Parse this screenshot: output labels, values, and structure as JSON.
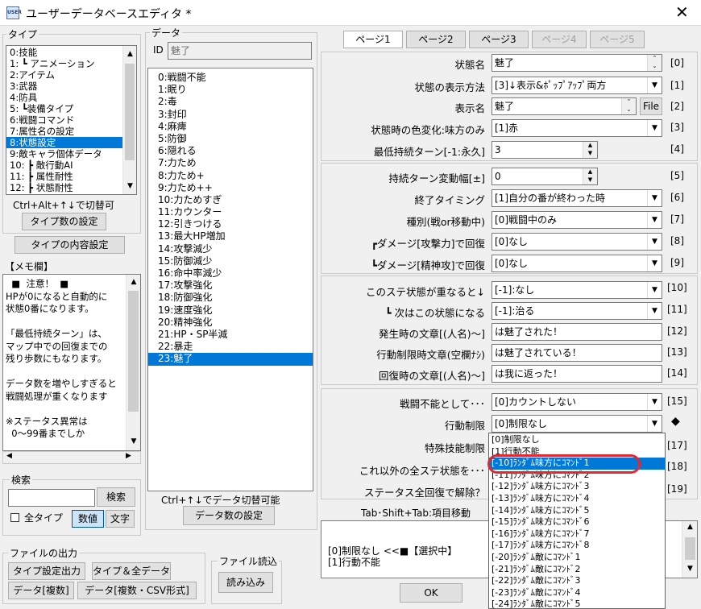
{
  "window": {
    "title": "ユーザーデータベースエディタ *",
    "icon_text": "USER"
  },
  "type_group": {
    "label": "タイプ",
    "items": [
      "0:技能",
      "1: ┗ アニメーション",
      "2:アイテム",
      "3:武器",
      "4:防具",
      "5: ┗装備タイプ",
      "6:戦闘コマンド",
      "7:属性名の設定",
      "8:状態設定",
      "9:敵キャラ個体データ",
      "10: ┣ 敵行動AI",
      "11: ┣ 属性耐性",
      "12: ┣ 状態耐性"
    ],
    "selected_index": 8,
    "hint": "Ctrl+Alt+↑↓で切替可",
    "count_button": "タイプ数の設定",
    "content_button": "タイプの内容設定"
  },
  "memo": {
    "label": "【メモ欄】",
    "lines": [
      "  ■  注意！  ■",
      "HPが0になると自動的に",
      "状態0番になります。",
      "",
      "「最低持続ターン」は、",
      "マップ中での回復までの",
      "残り歩数にもなります。",
      "",
      "データ数を増やしすぎると",
      "戦闘処理が重くなります",
      "",
      "※ステータス異常は",
      "  0〜99番までしか"
    ]
  },
  "search": {
    "label": "検索",
    "button": "検索",
    "all_types": "全タイプ",
    "numeric": "数値",
    "text": "文字"
  },
  "file_output": {
    "label": "ファイルの出力",
    "btn_type": "タイプ設定出力",
    "btn_type_all": "タイプ＆全データ",
    "btn_data": "データ[複数]",
    "btn_csv": "データ[複数・CSV形式]"
  },
  "file_input": {
    "label": "ファイル読込",
    "button": "読み込み"
  },
  "data_group": {
    "label": "データ",
    "id_label": "ID",
    "id_value": "魅了",
    "items": [
      "0:戦闘不能",
      "1:眠り",
      "2:毒",
      "3:封印",
      "4:麻痺",
      "5:防御",
      "6:隠れる",
      "7:力ため",
      "8:力ため+",
      "9:力ため++",
      "10:力ためすぎ",
      "11:カウンター",
      "12:引きつける",
      "13:最大HP増加",
      "14:攻撃減少",
      "15:防御減少",
      "16:命中率減少",
      "17:攻撃強化",
      "18:防御強化",
      "19:速度強化",
      "20:精神強化",
      "21:HP・SP半減",
      "22:暴走",
      "23:魅了"
    ],
    "selected_index": 23,
    "hint": "Ctrl+↑↓でデータ切替可能",
    "count_button": "データ数の設定"
  },
  "pages": [
    "ページ1",
    "ページ2",
    "ページ3",
    "ページ4",
    "ページ5"
  ],
  "section1": {
    "name_label": "状態名",
    "name_value": "魅了",
    "idx0": "[0]",
    "display_method_label": "状態の表示方法",
    "display_method_value": "[3]↓表示&ﾎﾟｯﾌﾟｱｯﾌﾟ両方",
    "idx1": "[1]",
    "display_name_label": "表示名",
    "display_name_value": "魅了",
    "file_button": "File",
    "idx2": "[2]",
    "color_label": "状態時の色変化:味方のみ",
    "color_value": "[1]赤",
    "idx3": "[3]",
    "min_turn_label": "最低持続ターン[-1:永久]",
    "min_turn_value": "3",
    "idx4": "[4]"
  },
  "section2": {
    "turn_var_label": "持続ターン変動幅[±]",
    "turn_var_value": "0",
    "idx5": "[5]",
    "end_timing_label": "終了タイミング",
    "end_timing_value": "[1]自分の番が終わった時",
    "idx6": "[6]",
    "kind_label": "種別(戦or移動中)",
    "kind_value": "[0]戦闘中のみ",
    "idx7": "[7]",
    "atk_heal_label": "┏ダメージ[攻撃力]で回復",
    "atk_heal_value": "[0]なし",
    "idx8": "[8]",
    "spi_heal_label": "┗ダメージ[精神攻]で回復",
    "spi_heal_value": "[0]なし",
    "idx9": "[9]"
  },
  "section3": {
    "overlap_label": "このステ状態が重なると↓",
    "overlap_value": "[-1]:なし",
    "idx10": "[10]",
    "next_label": "┗ 次はこの状態になる",
    "next_value": "[-1]:治る",
    "idx11": "[11]",
    "msg_start_label": "発生時の文章[(人名)〜]",
    "msg_start_value": "は魅了された！",
    "idx12": "[12]",
    "msg_restrict_label": "行動制限時文章(空欄ﾅｼ)",
    "msg_restrict_value": "は魅了されている！",
    "idx13": "[13]",
    "msg_heal_label": "回復時の文章[(人名)〜]",
    "msg_heal_value": "は我に返った！",
    "idx14": "[14]"
  },
  "section4": {
    "incap_label": "戦闘不能として･･･",
    "incap_value": "[0]カウントしない",
    "idx15": "[15]",
    "restrict_label": "行動制限",
    "restrict_value": "[0]制限なし",
    "diamond": "◆",
    "skill_restrict_label": "特殊技能制限",
    "idx17": "[17]",
    "other_label": "これ以外の全ステ状態を･･･",
    "idx18": "[18]",
    "release_label": "ステータス全回復で解除？",
    "idx19": "[19]"
  },
  "dropdown_list": {
    "items": [
      "[0]制限なし",
      "[1]行動不能",
      "[-10]ﾗﾝﾀﾞﾑ味方にｺﾏﾝﾄﾞ1",
      "[-11]ﾗﾝﾀﾞﾑ味方にｺﾏﾝﾄﾞ2",
      "[-12]ﾗﾝﾀﾞﾑ味方にｺﾏﾝﾄﾞ3",
      "[-13]ﾗﾝﾀﾞﾑ味方にｺﾏﾝﾄﾞ4",
      "[-14]ﾗﾝﾀﾞﾑ味方にｺﾏﾝﾄﾞ5",
      "[-15]ﾗﾝﾀﾞﾑ味方にｺﾏﾝﾄﾞ6",
      "[-16]ﾗﾝﾀﾞﾑ味方にｺﾏﾝﾄﾞ7",
      "[-17]ﾗﾝﾀﾞﾑ味方にｺﾏﾝﾄﾞ8",
      "[-20]ﾗﾝﾀﾞﾑ敵にｺﾏﾝﾄﾞ1",
      "[-21]ﾗﾝﾀﾞﾑ敵にｺﾏﾝﾄﾞ2",
      "[-22]ﾗﾝﾀﾞﾑ敵にｺﾏﾝﾄﾞ3",
      "[-23]ﾗﾝﾀﾞﾑ敵にｺﾏﾝﾄﾞ4",
      "[-24]ﾗﾝﾀﾞﾑ敵にｺﾏﾝﾄﾞ5"
    ],
    "selected_index": 2,
    "highlight_color": "#e8262b"
  },
  "hint_bar": {
    "text": "Tab･Shift+Tab:項目移動"
  },
  "help": {
    "line1": "[0]制限なし  <<■【選択中】",
    "line2": "[1]行動不能"
  },
  "ok_button": "OK"
}
